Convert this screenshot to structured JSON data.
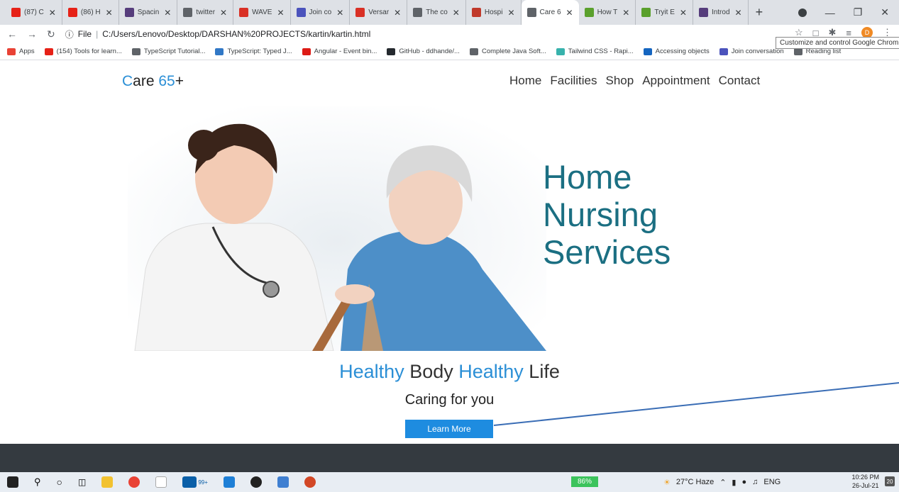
{
  "browser": {
    "tabs": [
      {
        "label": "(87) C",
        "color": "#e62117"
      },
      {
        "label": "(86) H",
        "color": "#e62117"
      },
      {
        "label": "Spacin",
        "color": "#563d7c"
      },
      {
        "label": "twitter",
        "color": "#5f6368"
      },
      {
        "label": "WAVE",
        "color": "#d93025"
      },
      {
        "label": "Join co",
        "color": "#4b53bc"
      },
      {
        "label": "Versar",
        "color": "#d93025"
      },
      {
        "label": "The co",
        "color": "#5f6368"
      },
      {
        "label": "Hospi",
        "color": "#c0392b"
      },
      {
        "label": "Care 6",
        "color": "#5f6368",
        "active": true
      },
      {
        "label": "How T",
        "color": "#5aa02c"
      },
      {
        "label": "Tryit E",
        "color": "#5aa02c"
      },
      {
        "label": "Introd",
        "color": "#563d7c"
      }
    ],
    "url_scheme": "File",
    "url": "C:/Users/Lenovo/Desktop/DARSHAN%20PROJECTS/kartin/kartin.html",
    "profile_initial": "D",
    "tooltip": "Customize and control Google Chrom",
    "bookmarks": [
      {
        "label": "Apps",
        "color": "#e94235"
      },
      {
        "label": "(154) Tools for learn...",
        "color": "#e62117"
      },
      {
        "label": "TypeScript Tutorial...",
        "color": "#5f6368"
      },
      {
        "label": "TypeScript: Typed J...",
        "color": "#3178c6"
      },
      {
        "label": "Angular - Event bin...",
        "color": "#dd1b16"
      },
      {
        "label": "GitHub - ddhande/...",
        "color": "#24292e"
      },
      {
        "label": "Complete Java Soft...",
        "color": "#5f6368"
      },
      {
        "label": "Tailwind CSS - Rapi...",
        "color": "#38b2ac"
      },
      {
        "label": "Accessing objects",
        "color": "#1565c0"
      },
      {
        "label": "Join conversation",
        "color": "#4b53bc"
      },
      {
        "label": "Reading list",
        "color": "#5f6368"
      }
    ]
  },
  "site": {
    "logo_c": "C",
    "logo_are": "are ",
    "logo_65": "65",
    "logo_plus": "+",
    "nav": [
      "Home",
      "Facilities",
      "Shop",
      "Appointment",
      "Contact"
    ],
    "hero_lines": [
      "Home",
      "Nursing",
      "Services"
    ],
    "tagline_1": "Healthy",
    "tagline_2": " Body ",
    "tagline_3": "Healthy",
    "tagline_4": " Life",
    "subtitle": "Caring for you",
    "cta": "Learn More"
  },
  "taskbar": {
    "battery": "86%",
    "weather": "27°C Haze",
    "lang": "ENG",
    "time": "10:26 PM",
    "date": "26-Jul-21",
    "notifications": "20",
    "store_badge": "99+"
  }
}
